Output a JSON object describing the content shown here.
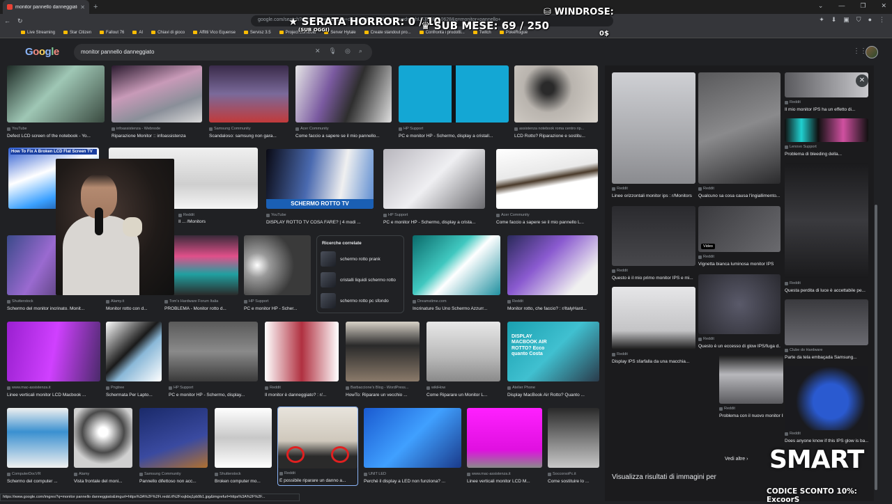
{
  "browser": {
    "tab_title": "monitor pannello danneggiato",
    "address": "google.com/search?q=monitor+pannello+danneggiato ... &sa=X&ved=2ahUKEwj8610628&q=monitor+pannello+",
    "bookmarks": [
      "Live Streaming",
      "Star Citizen",
      "Fallout 76",
      "AI",
      "Chiavi di gioco",
      "Affitti Vico Equense",
      "Servisz 3.5",
      "Project Zomboid",
      "Server Hytale",
      "Create standout pro...",
      "Confronta i prodotti...",
      "Twitch",
      "PokéRogue"
    ]
  },
  "overlay": {
    "serata_label": "SERATA HORROR:",
    "serata_sub": "(SUB OGGI)",
    "serata_value": "0 / 10",
    "sub_mese_label": "SUB MESE:",
    "sub_mese_value": "69 / 250",
    "windrose_label": "WINDROSE:",
    "windrose_value": "0$",
    "brand": "SMART",
    "promo": "CODICE SCONTO 10%: ExcoorS"
  },
  "search": {
    "logo": "Google",
    "query": "monitor pannello danneggiato"
  },
  "results": [
    {
      "src": "YouTube",
      "cap": "Defect LCD screen of the notebook - Yo..."
    },
    {
      "src": "infoassistenza - Webnode",
      "cap": "Riparazione Monitor :: infoassistenza"
    },
    {
      "src": "Samsung Community",
      "cap": "Scandaloso: samsung non gara..."
    },
    {
      "src": "Acer Community",
      "cap": "Come faccio a sapere se il mio pannello..."
    },
    {
      "src": "HP Support",
      "cap": "PC e monitor HP - Schermo, display a cristall..."
    },
    {
      "src": "assistenza notebook roma centro rip...",
      "cap": "LCD Rotto? Riparazione e sostitu..."
    },
    {
      "src": "Reddit",
      "cap": "Il ... /Monitors"
    },
    {
      "src": "YouTube",
      "cap": "DISPLAY ROTTO TV COSA FARE? | 4 modi ..."
    },
    {
      "src": "HP Support",
      "cap": "PC e monitor HP - Schermo, display a crista..."
    },
    {
      "src": "Acer Community",
      "cap": "Come faccio a sapere se il mio pannello L..."
    },
    {
      "src": "Shutterstock",
      "cap": "Schermo del monitor incrinato. Monit..."
    },
    {
      "src": "Alamy.it",
      "cap": "Monitor rotto con d..."
    },
    {
      "src": "Tom's Hardware Forum Italia",
      "cap": "PROBLEMA - Monitor rotto d..."
    },
    {
      "src": "HP Support",
      "cap": "PC e monitor HP - Scher..."
    },
    {
      "src": "Dreamstime.com",
      "cap": "Incrinature Su Uno Schermo Azzurr..."
    },
    {
      "src": "Reddit",
      "cap": "Monitor rotto, che faccio? : r/ItalyHard..."
    },
    {
      "src": "www.mac-assistenza.it",
      "cap": "Linee verticali monitor LCD Macbook ..."
    },
    {
      "src": "Pngtree",
      "cap": "Schermata Per Lapto..."
    },
    {
      "src": "HP Support",
      "cap": "PC e monitor HP - Schermo, display..."
    },
    {
      "src": "Reddit",
      "cap": "Il monitor è danneggiato? : r/..."
    },
    {
      "src": "Barbaccione's Blog - WordPress...",
      "cap": "HowTo: Riparare un vecchio ..."
    },
    {
      "src": "wikiHow",
      "cap": "Come Riparare un Monitor L..."
    },
    {
      "src": "Atelier Phone",
      "cap": "Display MacBook Air Rotto? Quanto ..."
    },
    {
      "src": "ComputerDocVR",
      "cap": "Schermo del computer ..."
    },
    {
      "src": "Alamy",
      "cap": "Vista frontale del moni..."
    },
    {
      "src": "Samsung Community",
      "cap": "Pannello difettoso non acc..."
    },
    {
      "src": "Shutterstock",
      "cap": "Broken computer mo..."
    },
    {
      "src": "Reddit",
      "cap": "È possibile riparare un danno a..."
    },
    {
      "src": "UNIT LED",
      "cap": "Perché il display a LED non funziona? ..."
    },
    {
      "src": "www.mac-assistenza.it",
      "cap": "Linee verticali monitor LCD M..."
    },
    {
      "src": "SoccorsoPc.it",
      "cap": "Come sostituire lo ..."
    }
  ],
  "thumb_text": {
    "how_to": "How To Fix A Broken LCD Flat Screen TV",
    "schermo_rotto": "SCHERMO ROTTO TV",
    "macbook": "DISPLAY MACBOOK AIR ROTTO? Ecco quanto Costa",
    "video": "Video"
  },
  "related": {
    "title": "Ricerche correlate",
    "items": [
      "schermo rotto prank",
      "cristalli liquidi schermo rotto",
      "schermo rotto pc sfondo"
    ]
  },
  "side": {
    "items": [
      {
        "src": "Reddit",
        "cap": "Il mio monitor IPS ha un effetto di..."
      },
      {
        "src": "Lenovo Support",
        "cap": "Problema di bleeding della..."
      },
      {
        "src": "Reddit",
        "cap": "Linee orizzontali monitor ips : r/Monitors"
      },
      {
        "src": "Reddit",
        "cap": "Qualcuno sa cosa causa l'ingiallimento..."
      },
      {
        "src": "Reddit",
        "cap": "Questo è il mio primo monitor IPS e mi..."
      },
      {
        "src": "Reddit",
        "cap": "Vignetta bianca luminosa monitor IPS"
      },
      {
        "src": "Reddit",
        "cap": "Questa perdita di luce è accettabile pe..."
      },
      {
        "src": "Reddit",
        "cap": "Display IPS sfarfalla da una macchia..."
      },
      {
        "src": "Reddit",
        "cap": "Questo è un eccesso di glow IPS/fuga d..."
      },
      {
        "src": "Clube do Hardware",
        "cap": "Parte da tela embaçada Samsung..."
      },
      {
        "src": "Reddit",
        "cap": "Problema con il nuovo monitor IPS. È..."
      },
      {
        "src": "Reddit",
        "cap": "Does anyone know if this IPS glow is ba..."
      }
    ],
    "more": "Vedi altre",
    "visualizza": "Visualizza risultati di immagini per"
  },
  "statusbar": "https://www.google.com/imgres?q=monitor pannello danneggiato&imgurl=https%3A%2F%2Fi.redd.it%2Fxsjkbq1pb9b1.jpg&imgrefurl=https%3A%2F%2F..."
}
